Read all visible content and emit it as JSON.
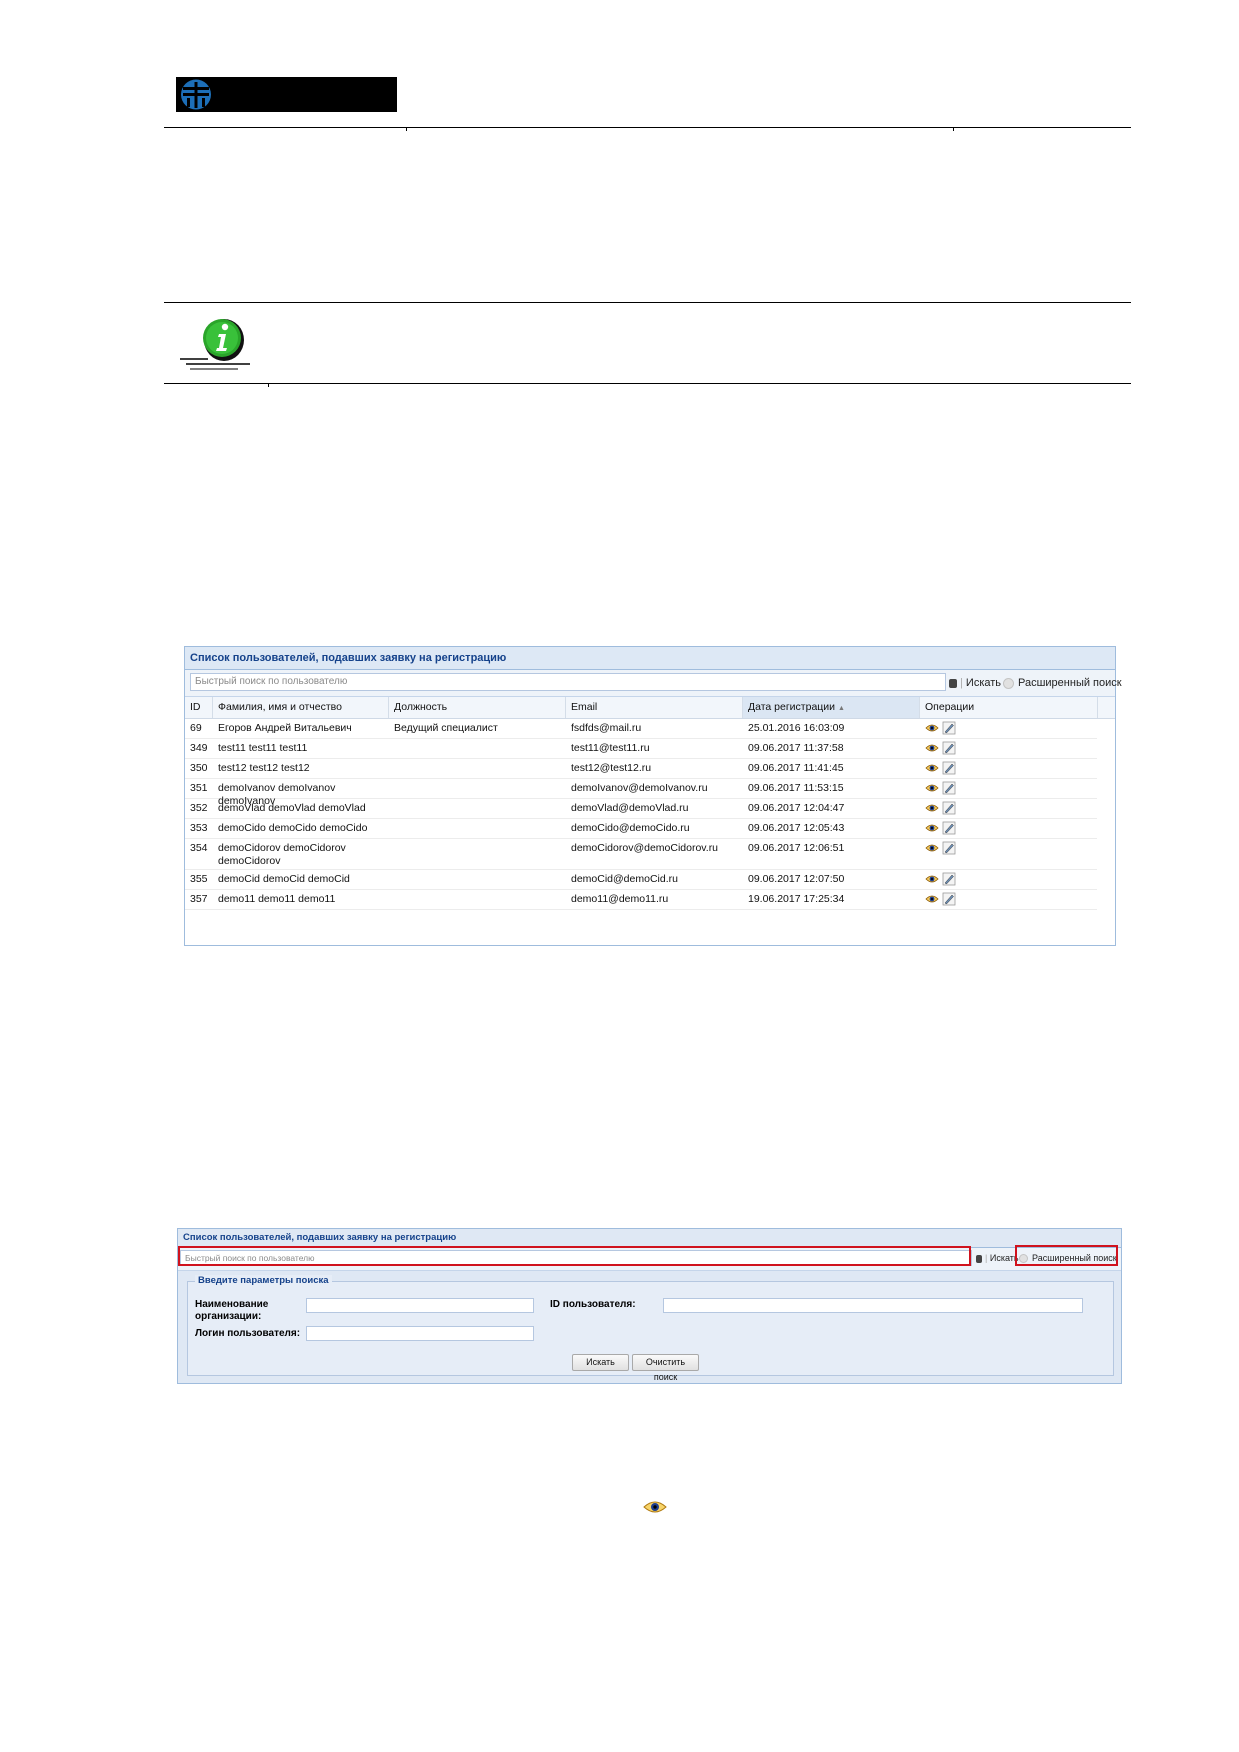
{
  "grid1": {
    "title": "Список пользователей, подавших заявку на регистрацию",
    "search_placeholder": "Быстрый поиск по пользователю",
    "search_button": "Искать",
    "advanced_button": "Расширенный поиск",
    "columns": [
      "ID",
      "Фамилия, имя и отчество",
      "Должность",
      "Email",
      "Дата регистрации",
      "Операции"
    ],
    "sorted_column": "Дата регистрации",
    "rows": [
      {
        "id": "69",
        "name": "Егоров Андрей Витальевич",
        "name2": "",
        "position": "Ведущий специалист",
        "email": "fsdfds@mail.ru",
        "date": "25.01.2016 16:03:09"
      },
      {
        "id": "349",
        "name": "test11 test11 test11",
        "name2": "",
        "position": "",
        "email": "test11@test11.ru",
        "date": "09.06.2017 11:37:58"
      },
      {
        "id": "350",
        "name": "test12 test12 test12",
        "name2": "",
        "position": "",
        "email": "test12@test12.ru",
        "date": "09.06.2017 11:41:45"
      },
      {
        "id": "351",
        "name": "demoIvanov demoIvanov demoIvanov",
        "name2": "",
        "position": "",
        "email": "demoIvanov@demoIvanov.ru",
        "date": "09.06.2017 11:53:15"
      },
      {
        "id": "352",
        "name": "demoVlad demoVlad demoVlad",
        "name2": "",
        "position": "",
        "email": "demoVlad@demoVlad.ru",
        "date": "09.06.2017 12:04:47"
      },
      {
        "id": "353",
        "name": "demoCido demoCido demoCido",
        "name2": "",
        "position": "",
        "email": "demoCido@demoCido.ru",
        "date": "09.06.2017 12:05:43"
      },
      {
        "id": "354",
        "name": "demoCidorov demoCidorov",
        "name2": "demoCidorov",
        "position": "",
        "email": "demoCidorov@demoCidorov.ru",
        "date": "09.06.2017 12:06:51"
      },
      {
        "id": "355",
        "name": "demoCid demoCid demoCid",
        "name2": "",
        "position": "",
        "email": "demoCid@demoCid.ru",
        "date": "09.06.2017 12:07:50"
      },
      {
        "id": "357",
        "name": "demo11 demo11 demo11",
        "name2": "",
        "position": "",
        "email": "demo11@demo11.ru",
        "date": "19.06.2017 17:25:34"
      }
    ]
  },
  "grid2": {
    "title": "Список пользователей, подавших заявку на регистрацию",
    "search_placeholder": "Быстрый поиск по пользователю",
    "search_button": "Искать",
    "advanced_button": "Расширенный поиск",
    "legend": "Введите параметры поиска",
    "label_org_line1": "Наименование",
    "label_org_line2": "организации:",
    "label_user_id": "ID пользователя:",
    "label_login": "Логин пользователя:",
    "btn_search": "Искать",
    "btn_clear": "Очистить поиск"
  },
  "icons": {
    "logo": "company-logo",
    "info": "info-icon",
    "view": "eye-icon",
    "edit": "edit-pencil-icon"
  },
  "colors": {
    "highlight": "#d0121d",
    "panel_title": "#15428b",
    "info_green": "#2aa52a"
  }
}
